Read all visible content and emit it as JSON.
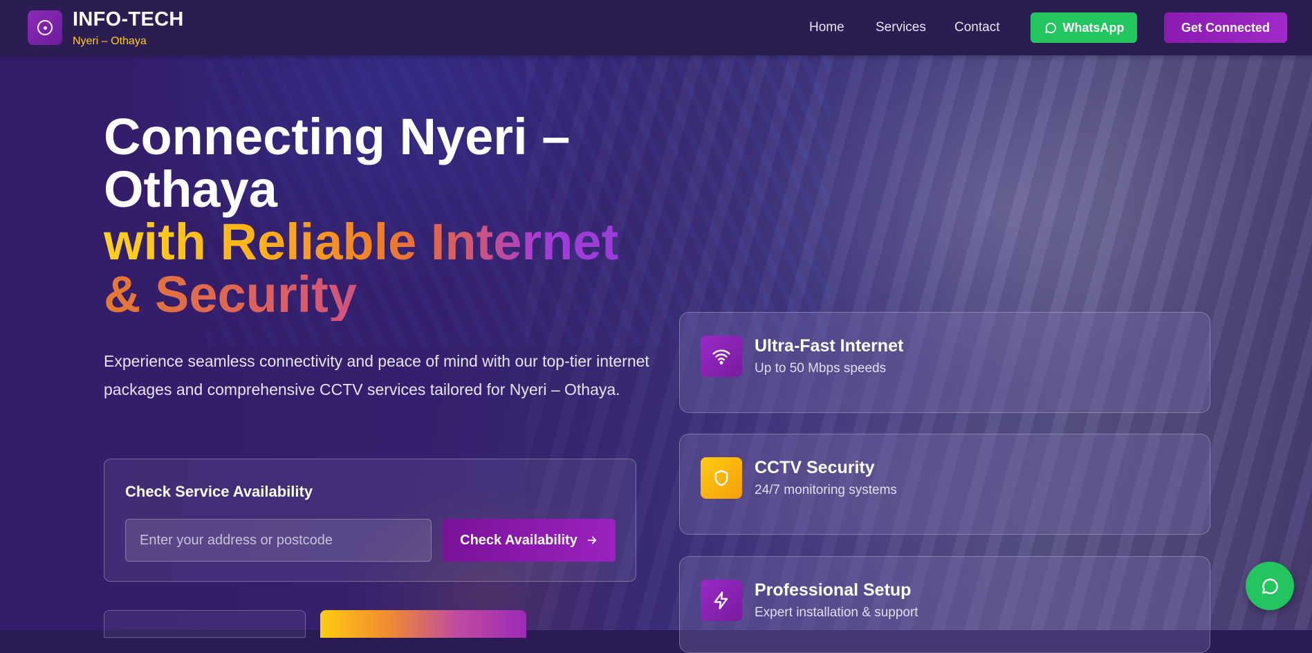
{
  "header": {
    "brand_title": "INFO-TECH",
    "brand_subtitle": "Nyeri – Othaya",
    "nav": [
      "Home",
      "Services",
      "Contact"
    ],
    "whatsapp_label": "WhatsApp",
    "cta_label": "Get Connected"
  },
  "hero": {
    "title_line1": "Connecting Nyeri –",
    "title_line2": "Othaya",
    "title_line3": "with Reliable Internet",
    "title_line4": "& Security",
    "lead": "Experience seamless connectivity and peace of mind with our top-tier internet packages and comprehensive CCTV services tailored for Nyeri – Othaya."
  },
  "availability": {
    "title": "Check Service Availability",
    "placeholder": "Enter your address or postcode",
    "value": "",
    "button_label": "Check Availability"
  },
  "features": [
    {
      "title": "Ultra-Fast Internet",
      "subtitle": "Up to 50 Mbps speeds",
      "icon": "wifi-icon"
    },
    {
      "title": "CCTV Security",
      "subtitle": "24/7 monitoring systems",
      "icon": "shield-icon"
    },
    {
      "title": "Professional Setup",
      "subtitle": "Expert installation & support",
      "icon": "lightning-icon"
    }
  ],
  "colors": {
    "header_bg": "#2b1d52",
    "accent_purple": "#8a1bb0",
    "whatsapp_green": "#22c55e",
    "accent_yellow": "#ffcc22"
  }
}
